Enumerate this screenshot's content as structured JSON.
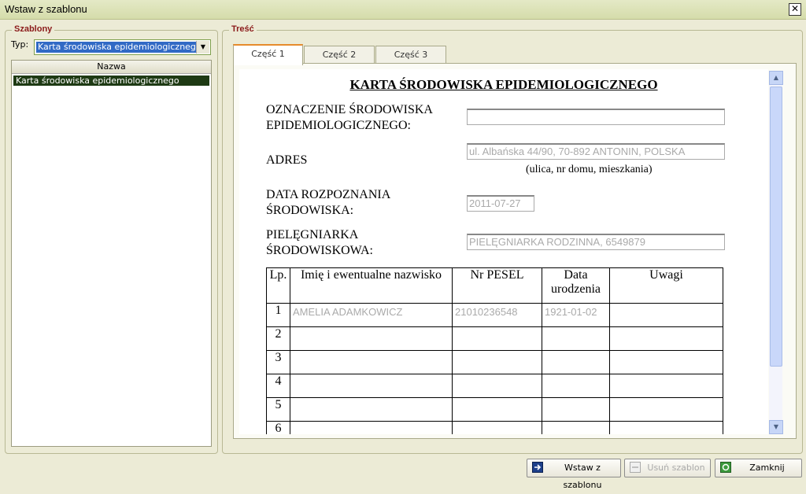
{
  "window": {
    "title": "Wstaw z szablonu",
    "close_glyph": "✕"
  },
  "templates": {
    "group_title": "Szablony",
    "type_label": "Typ:",
    "type_value": "Karta środowiska epidemiologicznego",
    "column_header": "Nazwa",
    "items": [
      "Karta środowiska epidemiologicznego"
    ]
  },
  "content": {
    "group_title": "Treść",
    "tabs": [
      "Część 1",
      "Część 2",
      "Część 3"
    ],
    "active_tab": 0
  },
  "doc": {
    "heading": "KARTA ŚRODOWISKA EPIDEMIOLOGICZNEGO",
    "field1": {
      "label_line1": "OZNACZENIE ŚRODOWISKA",
      "label_line2": "EPIDEMIOLOGICZNEGO:",
      "value": ""
    },
    "field2": {
      "label": "ADRES",
      "value": "ul. Albańska 44/90, 70-892 ANTONIN, POLSKA",
      "hint": "(ulica, nr domu, mieszkania)"
    },
    "field3": {
      "label_line1": "DATA ROZPOZNANIA",
      "label_line2": "ŚRODOWISKA:",
      "value": "2011-07-27"
    },
    "field4": {
      "label_line1": "PIELĘGNIARKA",
      "label_line2": "ŚRODOWISKOWA:",
      "value": "PIELĘGNIARKA RODZINNA, 6549879"
    },
    "table": {
      "headers": [
        "Lp.",
        "Imię i ewentualne nazwisko",
        "Nr PESEL",
        "Data urodzenia",
        "Uwagi"
      ],
      "rows": [
        {
          "lp": "1",
          "name": "AMELIA ADAMKOWICZ",
          "pesel": "21010236548",
          "dob": "1921-01-02",
          "notes": ""
        },
        {
          "lp": "2",
          "name": "",
          "pesel": "",
          "dob": "",
          "notes": ""
        },
        {
          "lp": "3",
          "name": "",
          "pesel": "",
          "dob": "",
          "notes": ""
        },
        {
          "lp": "4",
          "name": "",
          "pesel": "",
          "dob": "",
          "notes": ""
        },
        {
          "lp": "5",
          "name": "",
          "pesel": "",
          "dob": "",
          "notes": ""
        },
        {
          "lp": "6",
          "name": "",
          "pesel": "",
          "dob": "",
          "notes": ""
        }
      ]
    }
  },
  "buttons": {
    "insert": {
      "label": "Wstaw z szablonu",
      "icon": "insert-arrow-icon",
      "enabled": true
    },
    "delete": {
      "label": "Usuń szablon",
      "icon": "delete-template-icon",
      "enabled": false
    },
    "close": {
      "label": "Zamknij",
      "icon": "close-window-icon",
      "enabled": true
    }
  }
}
